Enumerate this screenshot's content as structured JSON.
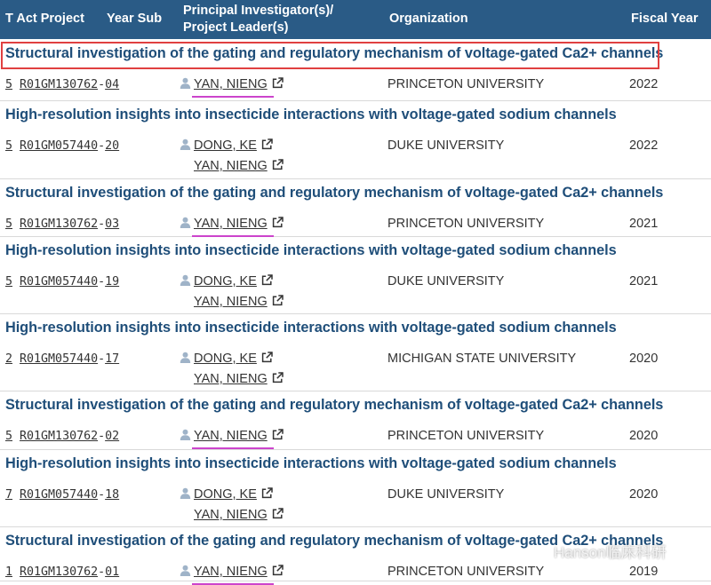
{
  "header": {
    "col1": "T Act Project",
    "col2": "Year Sub",
    "col3_line1": "Principal Investigator(s)/",
    "col3_line2": "Project Leader(s)",
    "col4": "Organization",
    "col5": "Fiscal Year"
  },
  "accent_colors": {
    "header_bg": "#2a5b86",
    "title": "#1f4e79",
    "highlight_box": "#e04040",
    "underline_mark": "#cc44cc"
  },
  "rows": [
    {
      "title": "Structural investigation of the gating and regulatory mechanism of voltage-gated Ca2+ channels",
      "type": "5",
      "project": "R01GM130762",
      "subproject": "04",
      "pis": [
        "YAN, NIENG"
      ],
      "org": "PRINCETON UNIVERSITY",
      "fy": "2022"
    },
    {
      "title": "High-resolution insights into insecticide interactions with voltage-gated sodium channels",
      "type": "5",
      "project": "R01GM057440",
      "subproject": "20",
      "pis": [
        "DONG, KE",
        "YAN, NIENG"
      ],
      "org": "DUKE UNIVERSITY",
      "fy": "2022"
    },
    {
      "title": "Structural investigation of the gating and regulatory mechanism of voltage-gated Ca2+ channels",
      "type": "5",
      "project": "R01GM130762",
      "subproject": "03",
      "pis": [
        "YAN, NIENG"
      ],
      "org": "PRINCETON UNIVERSITY",
      "fy": "2021"
    },
    {
      "title": "High-resolution insights into insecticide interactions with voltage-gated sodium channels",
      "type": "5",
      "project": "R01GM057440",
      "subproject": "19",
      "pis": [
        "DONG, KE",
        "YAN, NIENG"
      ],
      "org": "DUKE UNIVERSITY",
      "fy": "2021"
    },
    {
      "title": "High-resolution insights into insecticide interactions with voltage-gated sodium channels",
      "type": "2",
      "project": "R01GM057440",
      "subproject": "17",
      "pis": [
        "DONG, KE",
        "YAN, NIENG"
      ],
      "org": "MICHIGAN STATE UNIVERSITY",
      "fy": "2020"
    },
    {
      "title": "Structural investigation of the gating and regulatory mechanism of voltage-gated Ca2+ channels",
      "type": "5",
      "project": "R01GM130762",
      "subproject": "02",
      "pis": [
        "YAN, NIENG"
      ],
      "org": "PRINCETON UNIVERSITY",
      "fy": "2020"
    },
    {
      "title": "High-resolution insights into insecticide interactions with voltage-gated sodium channels",
      "type": "7",
      "project": "R01GM057440",
      "subproject": "18",
      "pis": [
        "DONG, KE",
        "YAN, NIENG"
      ],
      "org": "DUKE UNIVERSITY",
      "fy": "2020"
    },
    {
      "title": "Structural investigation of the gating and regulatory mechanism of voltage-gated Ca2+ channels",
      "type": "1",
      "project": "R01GM130762",
      "subproject": "01",
      "pis": [
        "YAN, NIENG"
      ],
      "org": "PRINCETON UNIVERSITY",
      "fy": "2019"
    }
  ],
  "watermark": "Hanson临床科研"
}
